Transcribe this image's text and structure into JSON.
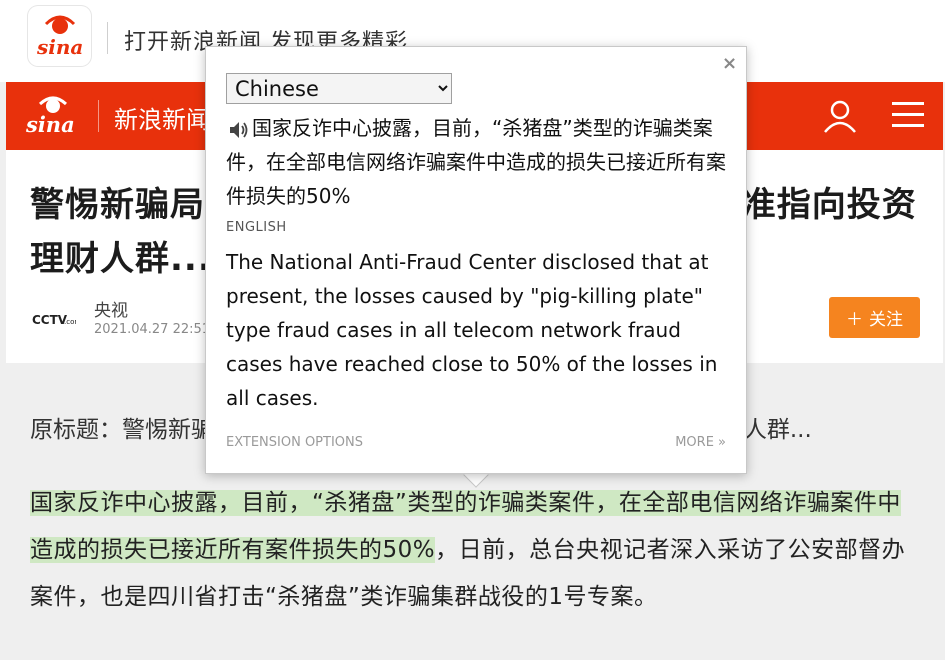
{
  "banner": {
    "logo_text": "sina",
    "tagline": "打开新浪新闻 发现更多精彩"
  },
  "navbar": {
    "logo_text": "sina",
    "title": "新浪新闻"
  },
  "article": {
    "headline": "警惕新骗局！“杀猪盘”类型诈骗升级，矛头精准指向投资理财人群...",
    "source_name": "央视",
    "source_date": "2021.04.27  22:51",
    "follow_label": "关注",
    "follow_icon": "plus-icon"
  },
  "body": {
    "original_title": "原标题：警惕新骗局！“杀猪盘”类型诈骗升级，矛头精准指向投资理财人群...",
    "highlighted": "国家反诈中心披露，目前，“杀猪盘”类型的诈骗类案件，在全部电信网络诈骗案件中造成的损失已接近所有案件损失的50%",
    "rest": "，日前，总台央视记者深入采访了公安部督办案件，也是四川省打击“杀猪盘”类诈骗集群战役的1号专案。"
  },
  "popup": {
    "language_selected": "Chinese",
    "language_options": [
      "Chinese"
    ],
    "close_glyph": "×",
    "source_text": "国家反诈中心披露，目前，“杀猪盘”类型的诈骗类案件，在全部电信网络诈骗案件中造成的损失已接近所有案件损失的50%",
    "target_language_label": "ENGLISH",
    "translation": "The National Anti-Fraud Center disclosed that at present, the losses caused by \"pig-killing plate\" type fraud cases in all telecom network fraud cases have reached close to 50% of the losses in all cases.",
    "extension_options_label": "EXTENSION OPTIONS",
    "more_label": "MORE »"
  },
  "colors": {
    "nav_red": "#e8310c",
    "follow_orange": "#f5841f",
    "highlight_green": "#cfe8c3"
  }
}
